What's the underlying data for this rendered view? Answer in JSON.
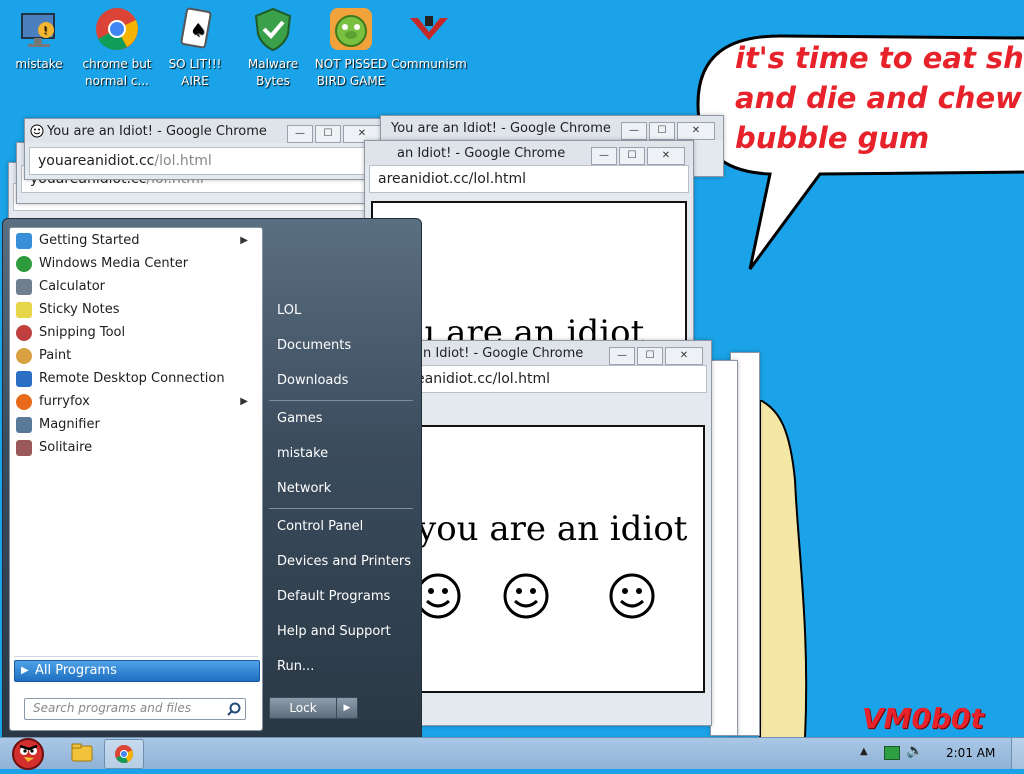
{
  "desktop": {
    "icons": [
      {
        "label": "mistake",
        "icon": "monitor-alert-icon"
      },
      {
        "label": "chrome but normal c...",
        "icon": "chrome-icon"
      },
      {
        "label": "SO LIT!!! AIRE",
        "icon": "playing-card-icon"
      },
      {
        "label": "Malware Bytes",
        "icon": "shield-check-icon"
      },
      {
        "label": "NOT PISSED BIRD GAME",
        "icon": "green-pig-icon"
      },
      {
        "label": "Communism",
        "icon": "red-emblem-icon"
      }
    ],
    "speech_bubble": [
      "it's time to eat shit",
      "and die and chew",
      "bubble gum"
    ],
    "watermark": "VM0b0t"
  },
  "windows": {
    "title": "You are an Idiot! - Google Chrome",
    "title_partial": "You are an Idiot! - Google Chrome",
    "title_partial2": "an Idiot! - Google Chrome",
    "title_partial3": "n Idiot! - Google Chrome",
    "url_full": "youareanidiot.cc/lol.html",
    "url_partial1": "areanidiot.cc/lol.html",
    "url_partial2": "eanidiot.cc/lol.html",
    "url_domain_part": "youareanidiot.cc",
    "url_path_part": "/lol.html",
    "heading_cut": "ou are an idiot",
    "heading": "you are an idiot",
    "min": "—",
    "max": "☐",
    "close": "✕"
  },
  "start_menu": {
    "programs": [
      {
        "label": "Getting Started",
        "icon": "getting-started-icon",
        "color": "#3a8fd9",
        "submenu": true
      },
      {
        "label": "Windows Media Center",
        "icon": "media-center-icon",
        "color": "#2f9a3a",
        "submenu": false
      },
      {
        "label": "Calculator",
        "icon": "calculator-icon",
        "color": "#6f7f8f",
        "submenu": false
      },
      {
        "label": "Sticky Notes",
        "icon": "sticky-notes-icon",
        "color": "#e8d64a",
        "submenu": false
      },
      {
        "label": "Snipping Tool",
        "icon": "scissors-icon",
        "color": "#c04040",
        "submenu": false
      },
      {
        "label": "Paint",
        "icon": "paint-icon",
        "color": "#d8a040",
        "submenu": false
      },
      {
        "label": "Remote Desktop Connection",
        "icon": "remote-desktop-icon",
        "color": "#2b6fc4",
        "submenu": false
      },
      {
        "label": "furryfox",
        "icon": "firefox-icon",
        "color": "#e86a1a",
        "submenu": true
      },
      {
        "label": "Magnifier",
        "icon": "magnifier-icon",
        "color": "#5a7a9a",
        "submenu": false
      },
      {
        "label": "Solitaire",
        "icon": "cards-icon",
        "color": "#9a5a5a",
        "submenu": false
      }
    ],
    "all_programs": "All Programs",
    "search_placeholder": "Search programs and files",
    "right_links": [
      "LOL",
      "Documents",
      "Downloads",
      "Games",
      "mistake",
      "Network",
      "Control Panel",
      "Devices and Printers",
      "Default Programs",
      "Help and Support",
      "Run..."
    ],
    "lock_label": "Lock"
  },
  "taskbar": {
    "time": "2:01 AM"
  }
}
